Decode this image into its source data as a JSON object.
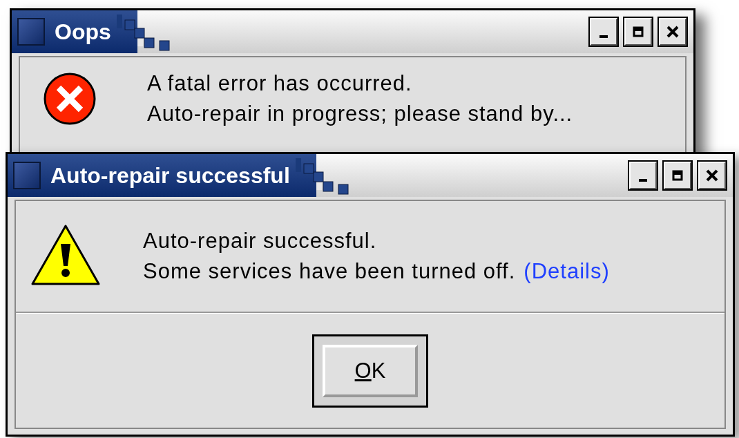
{
  "windows": [
    {
      "title": "Oops",
      "kind": "error",
      "lines": [
        "A fatal error has occurred.",
        "Auto-repair in progress; please stand by..."
      ]
    },
    {
      "title": "Auto-repair successful",
      "kind": "warning",
      "lines": [
        "Auto-repair successful.",
        "Some services have been turned off."
      ],
      "link": "(Details)",
      "ok_button": {
        "label": "OK"
      }
    }
  ]
}
